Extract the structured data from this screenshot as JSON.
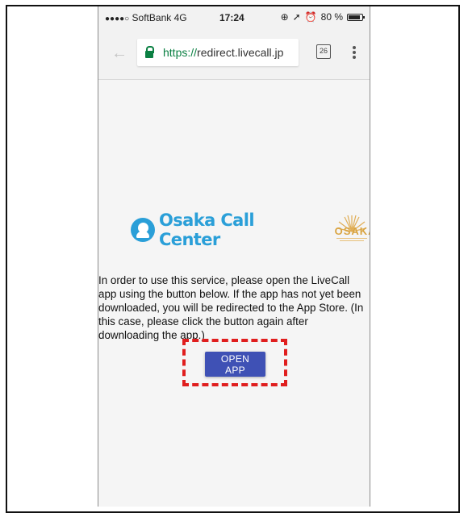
{
  "status_bar": {
    "carrier": "SoftBank",
    "network": "4G",
    "time": "17:24",
    "battery": "80 %"
  },
  "toolbar": {
    "url_scheme": "https://",
    "url_host": "redirect.livecall.jp",
    "tab_count": "26"
  },
  "logo": {
    "brand": "Osaka Call Center",
    "partner_logo": "OSAKA"
  },
  "message": "In order to use this service, please open the LiveCall app using the button below. If the app has not yet been downloaded, you will be redirected to the App Store. (In this case, please click the button again after downloading the app.)",
  "open_button": "OPEN APP",
  "colors": {
    "button": "#3f51b5",
    "highlight": "#e01e1e",
    "secure_green": "#0b8043",
    "brand_blue": "#2a9fd8"
  }
}
